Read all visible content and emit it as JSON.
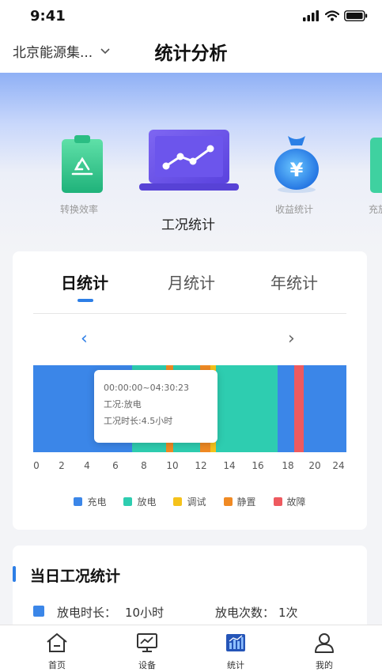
{
  "status": {
    "time": "9:41"
  },
  "nav": {
    "company": "北京能源集...",
    "title": "统计分析"
  },
  "features": [
    {
      "label": "转换效率",
      "icon": "recycle-clipboard-icon"
    },
    {
      "label": "工况统计",
      "icon": "laptop-chart-icon"
    },
    {
      "label": "收益统计",
      "icon": "money-bag-icon"
    },
    {
      "label": "充放",
      "icon": "partial-card-icon"
    }
  ],
  "tabs": {
    "day": "日统计",
    "month": "月统计",
    "year": "年统计"
  },
  "nav_arrows": {
    "prev": "‹",
    "next": "›"
  },
  "timeline": {
    "range_hours": [
      0,
      24
    ],
    "segments": [
      {
        "start": 0,
        "end": 7.6,
        "state": "充电"
      },
      {
        "start": 7.6,
        "end": 10.2,
        "state": "放电"
      },
      {
        "start": 10.2,
        "end": 10.7,
        "state": "静置"
      },
      {
        "start": 10.7,
        "end": 12.8,
        "state": "放电"
      },
      {
        "start": 12.8,
        "end": 13.6,
        "state": "静置"
      },
      {
        "start": 13.6,
        "end": 14.0,
        "state": "调试"
      },
      {
        "start": 14.0,
        "end": 18.7,
        "state": "放电"
      },
      {
        "start": 18.7,
        "end": 20.0,
        "state": "充电"
      },
      {
        "start": 20.0,
        "end": 20.7,
        "state": "故障"
      },
      {
        "start": 20.7,
        "end": 24,
        "state": "充电"
      }
    ],
    "ticks": [
      "0",
      "2",
      "4",
      "6",
      "8",
      "10",
      "12",
      "14",
      "16",
      "18",
      "20",
      "24"
    ]
  },
  "tooltip": {
    "time_range": "00:00:00~04:30:23",
    "status": "工况:放电",
    "duration": "工况时长:4.5小时"
  },
  "legend": [
    {
      "label": "充电",
      "color": "#3b86e8"
    },
    {
      "label": "放电",
      "color": "#2ecdb0"
    },
    {
      "label": "调试",
      "color": "#f5c21b"
    },
    {
      "label": "静置",
      "color": "#f08a24"
    },
    {
      "label": "故障",
      "color": "#ee5a5f"
    }
  ],
  "daily": {
    "title": "当日工况统计",
    "discharge_duration_label": "放电时长：",
    "discharge_duration_value": "10小时",
    "discharge_count_label": "放电次数：",
    "discharge_count_value": "1次"
  },
  "tabbar": {
    "home": "首页",
    "devices": "设备",
    "stats": "统计",
    "mine": "我的"
  }
}
